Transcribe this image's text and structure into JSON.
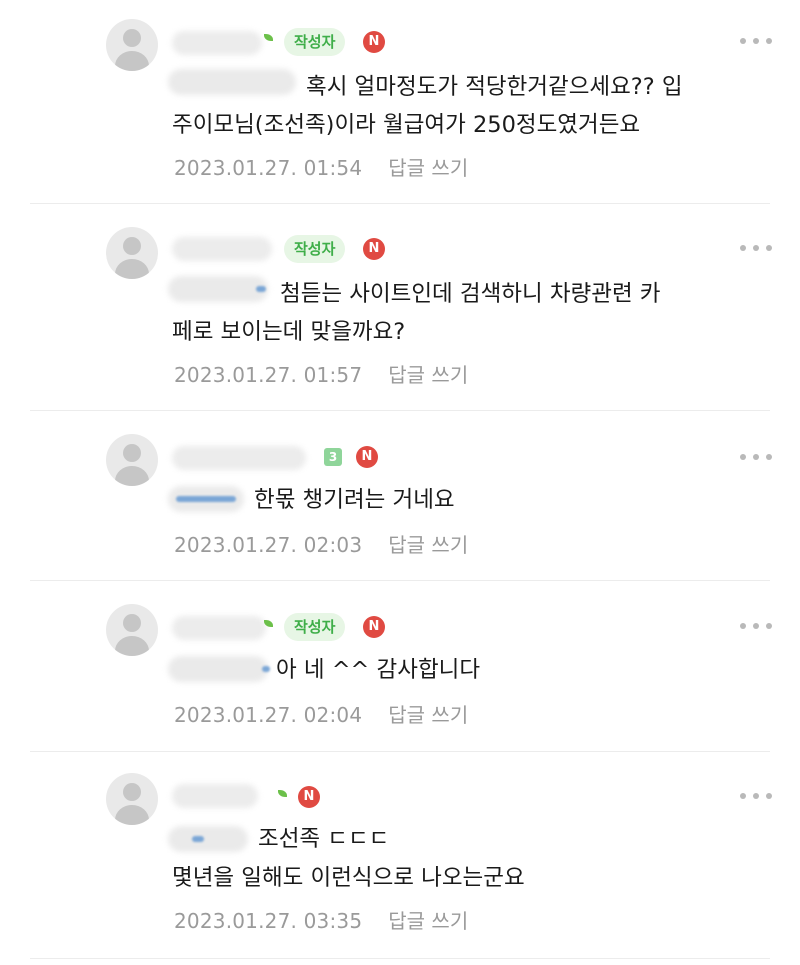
{
  "comments": [
    {
      "author_badge": "작성자",
      "n_badge": "N",
      "text_lines": [
        "혹시 얼마정도가 적당한거같으세요?? 입",
        "주이모님(조선족)이라 월급여가 250정도였거든요"
      ],
      "date": "2023.01.27. 01:54",
      "reply": "답글 쓰기"
    },
    {
      "author_badge": "작성자",
      "n_badge": "N",
      "text_lines": [
        "첨듣는 사이트인데 검색하니 차량관련 카",
        "페로 보이는데 맞을까요?"
      ],
      "date": "2023.01.27. 01:57",
      "reply": "답글 쓰기"
    },
    {
      "level_badge": "3",
      "n_badge": "N",
      "text_lines": [
        "한몫 챙기려는 거네요"
      ],
      "date": "2023.01.27. 02:03",
      "reply": "답글 쓰기"
    },
    {
      "author_badge": "작성자",
      "n_badge": "N",
      "text_lines": [
        "아 네 ^^ 감사합니다"
      ],
      "date": "2023.01.27. 02:04",
      "reply": "답글 쓰기"
    },
    {
      "n_badge": "N",
      "text_lines": [
        "조선족 ㄷㄷㄷ",
        "몇년을 일해도 이런식으로 나오는군요"
      ],
      "date": "2023.01.27. 03:35",
      "reply": "답글 쓰기"
    }
  ],
  "icons": {
    "avatar": "default-profile-icon",
    "more": "more-options-icon",
    "sprout": "sprout-level-icon"
  },
  "colors": {
    "author_badge_bg": "#e7f6e5",
    "author_badge_text": "#3fae49",
    "n_badge": "#e04a42",
    "meta_text": "#9a9a9a"
  }
}
